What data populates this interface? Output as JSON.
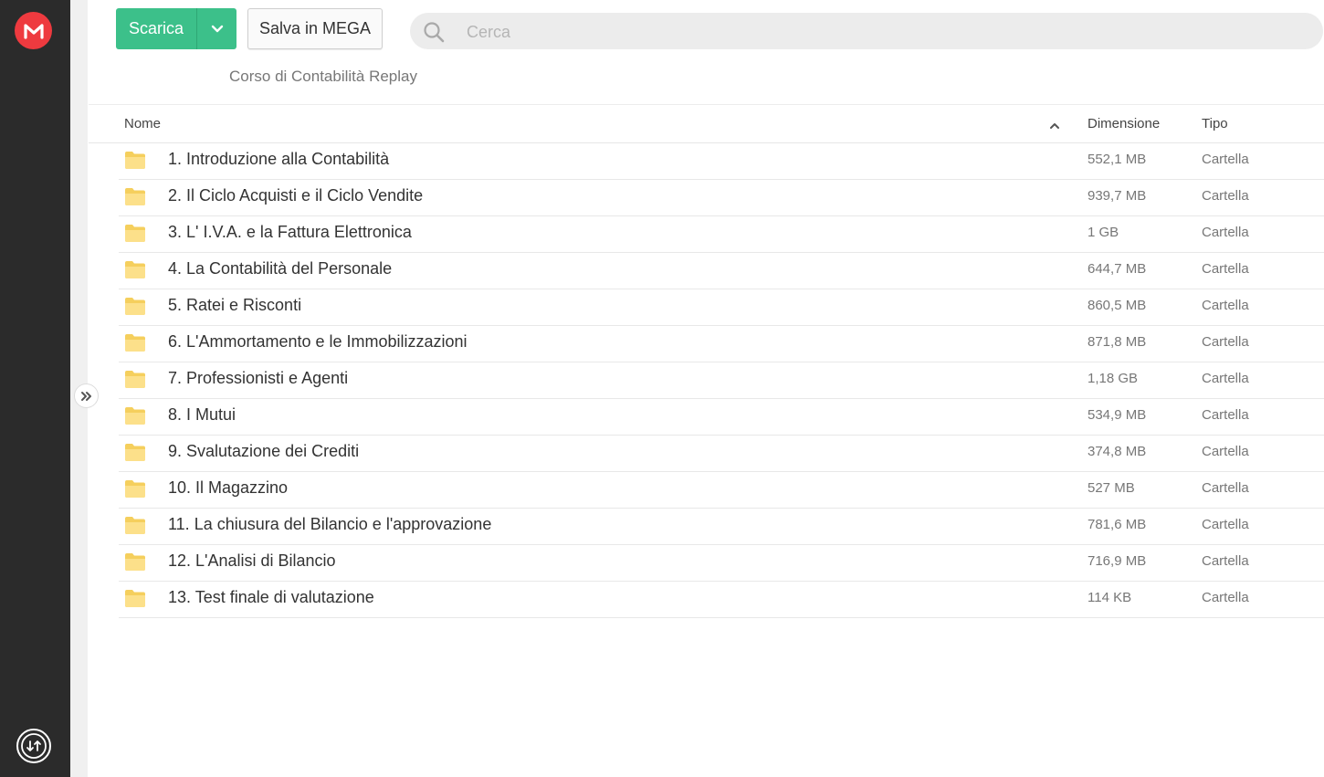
{
  "toolbar": {
    "download_label": "Scarica",
    "save_label": "Salva in MEGA"
  },
  "search": {
    "placeholder": "Cerca"
  },
  "breadcrumb": {
    "folder_name": "Corso di Contabilità Replay"
  },
  "table": {
    "headers": {
      "name": "Nome",
      "size": "Dimensione",
      "type": "Tipo"
    },
    "sort": "name-ascending",
    "rows": [
      {
        "name": "1. Introduzione alla Contabilità",
        "size": "552,1 MB",
        "type": "Cartella"
      },
      {
        "name": "2. Il Ciclo Acquisti e il Ciclo Vendite",
        "size": "939,7 MB",
        "type": "Cartella"
      },
      {
        "name": "3. L' I.V.A. e la Fattura Elettronica",
        "size": "1 GB",
        "type": "Cartella"
      },
      {
        "name": "4. La Contabilità del Personale",
        "size": "644,7 MB",
        "type": "Cartella"
      },
      {
        "name": "5. Ratei e Risconti",
        "size": "860,5 MB",
        "type": "Cartella"
      },
      {
        "name": "6. L'Ammortamento e le Immobilizzazioni",
        "size": "871,8 MB",
        "type": "Cartella"
      },
      {
        "name": "7. Professionisti e Agenti",
        "size": "1,18 GB",
        "type": "Cartella"
      },
      {
        "name": "8. I Mutui",
        "size": "534,9 MB",
        "type": "Cartella"
      },
      {
        "name": "9. Svalutazione dei Crediti",
        "size": "374,8 MB",
        "type": "Cartella"
      },
      {
        "name": "10. Il Magazzino",
        "size": "527 MB",
        "type": "Cartella"
      },
      {
        "name": "11. La chiusura del Bilancio e l'approvazione",
        "size": "781,6 MB",
        "type": "Cartella"
      },
      {
        "name": "12. L'Analisi di Bilancio",
        "size": "716,9 MB",
        "type": "Cartella"
      },
      {
        "name": "13. Test finale di valutazione",
        "size": "114 KB",
        "type": "Cartella"
      }
    ]
  },
  "icons": {
    "logo": "mega-logo-icon",
    "transfer": "transfer-icon",
    "expand": "double-chevron-right-icon",
    "search": "search-icon",
    "folder": "folder-icon"
  },
  "colors": {
    "brand_red": "#ee3a3f",
    "download_green": "#3cc08a",
    "sidebar_dark": "#2b2b2b",
    "folder_yellow": "#f5cf5d"
  }
}
